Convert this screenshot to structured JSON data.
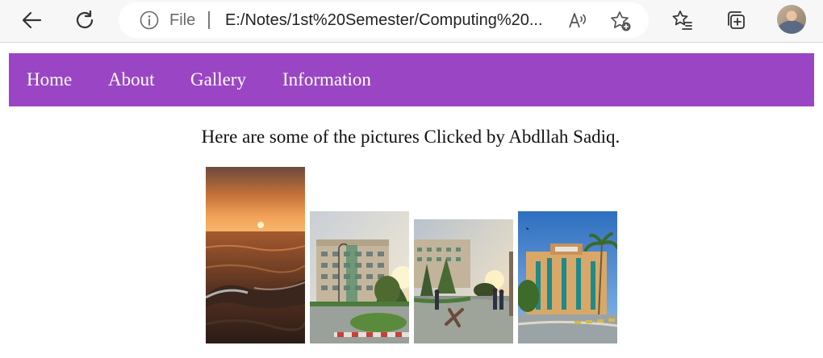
{
  "browser": {
    "back_icon": "back-arrow-icon",
    "refresh_icon": "refresh-icon",
    "info_icon": "info-icon",
    "file_label": "File",
    "url": "E:/Notes/1st%20Semester/Computing%20...",
    "read_aloud_icon": "read-aloud-icon",
    "add_favorite_icon": "add-favorite-icon",
    "favorites_icon": "favorites-icon",
    "collections_icon": "collections-icon",
    "profile_icon": "profile-avatar"
  },
  "nav": {
    "items": [
      {
        "label": "Home"
      },
      {
        "label": "About"
      },
      {
        "label": "Gallery"
      },
      {
        "label": "Information"
      }
    ],
    "background": "#9a46c4",
    "text_color": "#ffffff"
  },
  "main": {
    "caption": "Here are some of the pictures Clicked by Abdllah Sadiq.",
    "photos": [
      {
        "subject": "sunset over sea"
      },
      {
        "subject": "campus building at sunset"
      },
      {
        "subject": "campus courtyard with people at sunset"
      },
      {
        "subject": "campus building under blue sky"
      }
    ]
  }
}
